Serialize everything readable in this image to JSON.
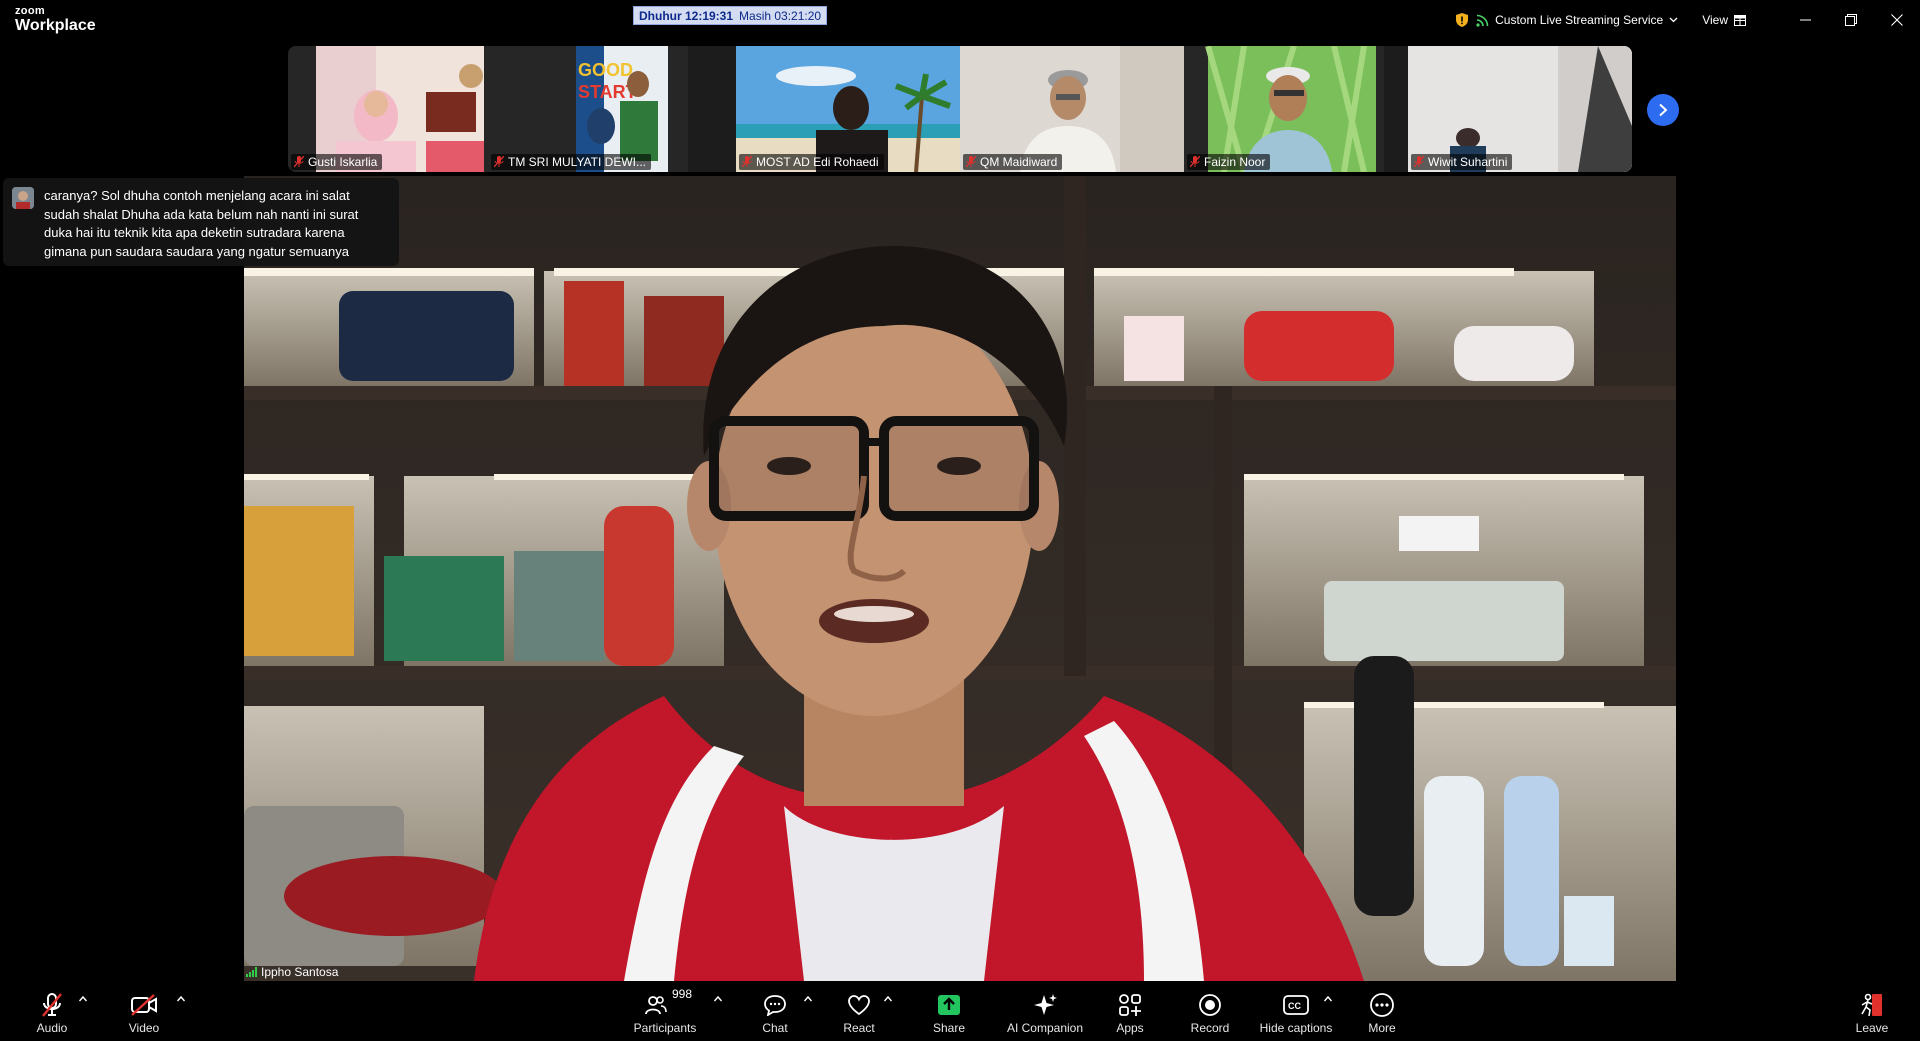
{
  "app": {
    "brand_small": "zoom",
    "brand_large": "Workplace"
  },
  "prayer_timer": {
    "label": "Dhuhur 12:19:31",
    "remaining": "Masih 03:21:20"
  },
  "titlebar": {
    "streaming_label": "Custom Live Streaming Service",
    "view_label": "View"
  },
  "participants_strip": [
    {
      "name": "Gusti Iskarlia",
      "muted": true
    },
    {
      "name": "TM SRI MULYATI DEWI...",
      "muted": true
    },
    {
      "name": "MOST AD Edi Rohaedi",
      "muted": true
    },
    {
      "name": "QM Maidiward",
      "muted": true
    },
    {
      "name": "Faizin Noor",
      "muted": true
    },
    {
      "name": "Wiwit Suhartini",
      "muted": true
    }
  ],
  "active_speaker": {
    "name": "Ippho Santosa"
  },
  "caption": {
    "text": "caranya? Sol dhuha contoh menjelang acara ini salat sudah shalat Dhuha ada kata belum nah nanti ini surat duka hai itu teknik kita apa deketin sutradara karena gimana pun saudara saudara yang ngatur semuanya"
  },
  "toolbar": {
    "audio": "Audio",
    "video": "Video",
    "participants": "Participants",
    "participants_count": "998",
    "chat": "Chat",
    "react": "React",
    "share": "Share",
    "ai_companion": "AI Companion",
    "apps": "Apps",
    "record": "Record",
    "hide_captions": "Hide captions",
    "more": "More",
    "leave": "Leave"
  },
  "colors": {
    "share_green": "#22c55e",
    "next_blue": "#2d6cf1",
    "muted_red": "#e0312c",
    "timer_bg": "#d4dcf2"
  }
}
